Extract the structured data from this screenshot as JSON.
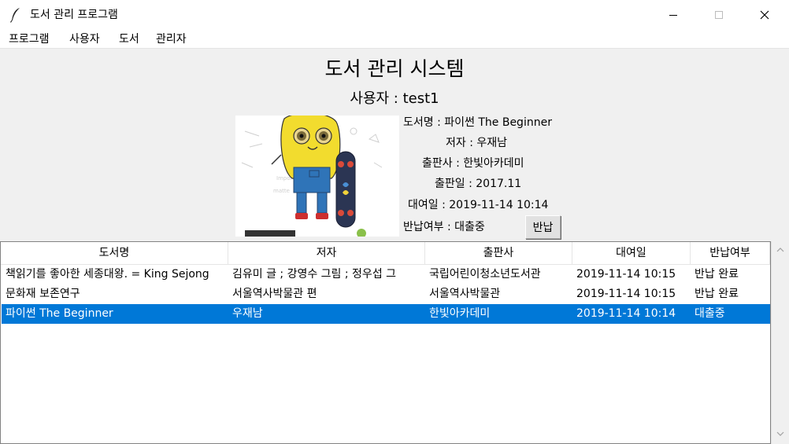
{
  "window": {
    "title": "도서 관리 프로그램",
    "icons": {
      "app": "feather-icon",
      "minimize": "minimize-icon",
      "maximize": "maximize-icon",
      "close": "close-icon"
    }
  },
  "menu": [
    "프로그램",
    "사용자",
    "도서",
    "관리자"
  ],
  "header": {
    "title": "도서 관리 시스템",
    "user_line": "사용자 : test1"
  },
  "book": {
    "cover": "book-cover-image",
    "title_line": "도서명 : 파이썬 The Beginner",
    "author_line": "저자  : 우재남",
    "publisher_line": "출판사 : 한빛아카데미",
    "pubdate_line": "출판일 : 2017.11",
    "loan_line": "대여일 : 2019-11-14 10:14",
    "status_line": "반납여부 : 대출중",
    "return_button": "반납"
  },
  "table": {
    "columns": [
      "도서명",
      "저자",
      "출판사",
      "대여일",
      "반납여부"
    ],
    "rows": [
      [
        "책읽기를 좋아한 세종대왕. = King Sejong",
        "김유미 글 ;  강영수 그림 ; 정우섭 그",
        "국립어린이청소년도서관",
        "2019-11-14 10:15",
        "반납 완료"
      ],
      [
        "문화재 보존연구",
        "서울역사박물관 편",
        "서울역사박물관",
        "2019-11-14 10:15",
        "반납 완료"
      ],
      [
        "파이썬 The Beginner",
        "우재남",
        "한빛아카데미",
        "2019-11-14 10:14",
        "대출중"
      ]
    ],
    "selected_row": 2,
    "selection_color": "#0078d7"
  },
  "scrollbar": {
    "up": "scroll-up-arrow-icon",
    "down": "scroll-down-arrow-icon"
  }
}
